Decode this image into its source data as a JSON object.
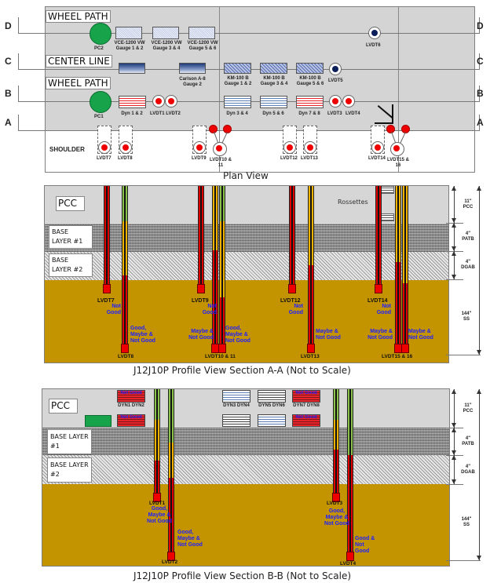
{
  "plan_view": {
    "caption": "Plan View",
    "row_labels": {
      "wheel_path_top": "WHEEL PATH",
      "center_line": "CENTER LINE",
      "wheel_path_bottom": "WHEEL PATH",
      "shoulder": "SHOULDER"
    },
    "section_letters": [
      "D",
      "C",
      "B",
      "A"
    ],
    "pressure_cells": [
      "PC2",
      "PC1"
    ],
    "vw_gauges": [
      "VCE-1200 VW Gauge 1 & 2",
      "VCE-1200 VW Gauge 3 & 4",
      "VCE-1200 VW Gauge 5 & 6"
    ],
    "carlson": "Carlson A-8 Gauge 2",
    "km_gauges": [
      "KM-100 B Gauge 1 & 2",
      "KM-100 B Gauge 3 & 4",
      "KM-100 B Gauge 5 & 6"
    ],
    "dyn_gauges": [
      "Dyn 1 & 2",
      "Dyn 3 & 4",
      "Dyn 5 & 6",
      "Dyn 7 & 8"
    ],
    "lvdts": {
      "lvdt6": "LVDT6",
      "lvdt5": "LVDT5",
      "lvdt1_2": "LVDT1 LVDT2",
      "lvdt3": "LVDT3",
      "lvdt4": "LVDT4",
      "lvdt7": "LVDT7",
      "lvdt8": "LVDT8",
      "lvdt9": "LVDT9",
      "lvdt10_11": "LVDT10 & 11",
      "lvdt12": "LVDT12",
      "lvdt13": "LVDT13",
      "lvdt14": "LVDT14",
      "lvdt15_16": "LVDT15 & 16"
    }
  },
  "layers": {
    "pcc": "PCC",
    "base1": "BASE LAYER #1",
    "base2": "BASE LAYER #2",
    "rossettes": "Rossettes",
    "dims": [
      {
        "value": "11\"",
        "name": "PCC"
      },
      {
        "value": "4\"",
        "name": "PATB"
      },
      {
        "value": "4\"",
        "name": "DGAB"
      },
      {
        "value": "144\"",
        "name": "SS"
      }
    ]
  },
  "section_aa": {
    "caption": "J12J10P Profile View Section A-A (Not to Scale)",
    "sensors": [
      {
        "label": "LVDT7",
        "status": "Not Good"
      },
      {
        "label": "LVDT8",
        "status": "Good, Maybe & Not Good"
      },
      {
        "label": "LVDT9",
        "status": "Not Good"
      },
      {
        "label": "LVDT10 & 11",
        "status_left": "Maybe & Not Good",
        "status_right": "Good, Maybe & Not Good"
      },
      {
        "label": "LVDT12",
        "status": "Not Good"
      },
      {
        "label": "LVDT13",
        "status": "Maybe & Not Good"
      },
      {
        "label": "LVDT14",
        "status": "Not Good"
      },
      {
        "label": "LVDT15 & 16",
        "status_left": "Maybe & Not Good",
        "status_right": "Maybe & Not Good"
      }
    ]
  },
  "section_bb": {
    "caption": "J12J10P Profile View Section B-B (Not to Scale)",
    "dyn_labels": [
      "DYN1 DYN2",
      "DYN3 DYN4",
      "DYN5 DYN6",
      "DYN7 DYN8"
    ],
    "dyn_status": "Not Good",
    "sensors": [
      {
        "label": "LVDT1",
        "status": "Good, Maybe & Not Good"
      },
      {
        "label": "LVDT2",
        "status": "Good, Maybe & Not Good"
      },
      {
        "label": "LVDT3",
        "status": "Good, Maybe & Not Good"
      },
      {
        "label": "LVDT4",
        "status": "Good & Not Good"
      }
    ]
  },
  "colors": {
    "good": "#8bc34a",
    "maybe": "#f0b400",
    "not_good": "#e00000",
    "status_text": "#2020ff",
    "subgrade": "#c49400"
  }
}
